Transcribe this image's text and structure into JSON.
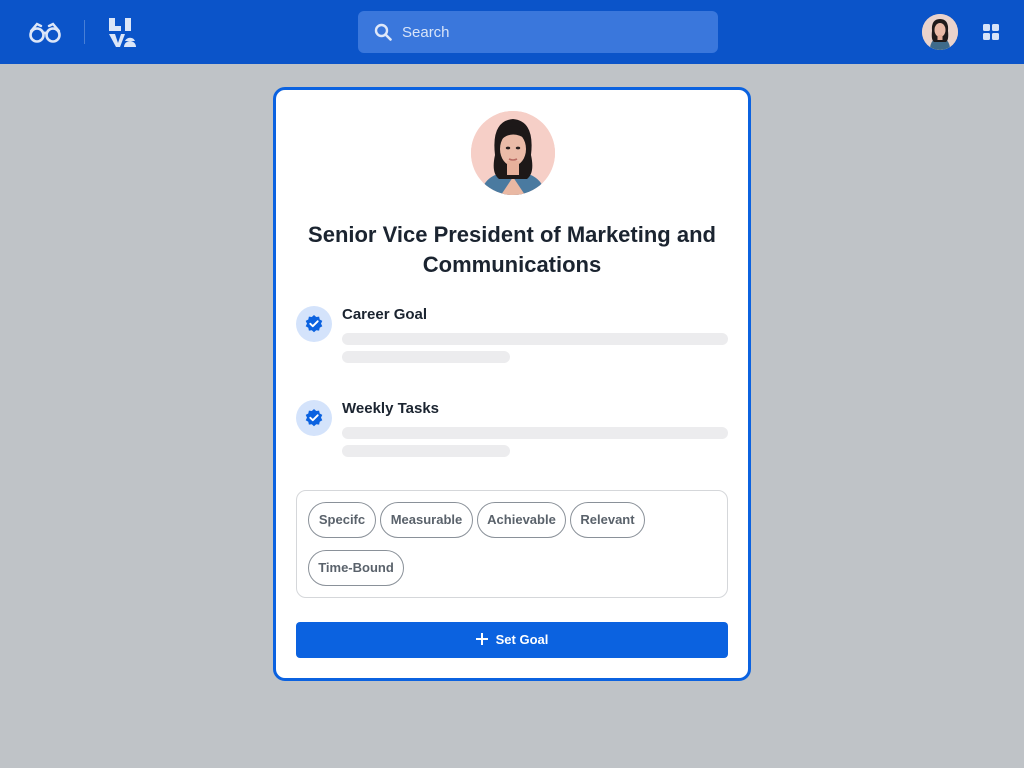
{
  "header": {
    "search": {
      "placeholder": "Search",
      "value": ""
    },
    "icons": [
      "glasses-logo",
      "brand-logo",
      "search-icon",
      "avatar",
      "apps-grid-icon"
    ]
  },
  "card": {
    "title": "Senior Vice President of Marketing and Communications",
    "items": [
      {
        "title": "Career Goal",
        "icon": "verified-check-icon"
      },
      {
        "title": "Weekly Tasks",
        "icon": "verified-check-icon"
      }
    ],
    "tags": [
      "Specifc",
      "Measurable",
      "Achievable",
      "Relevant",
      "Time-Bound"
    ],
    "button_label": "Set Goal"
  },
  "colors": {
    "brand_blue": "#0b54c9",
    "accent_blue": "#0b62e0",
    "background": "#bfc3c7"
  }
}
